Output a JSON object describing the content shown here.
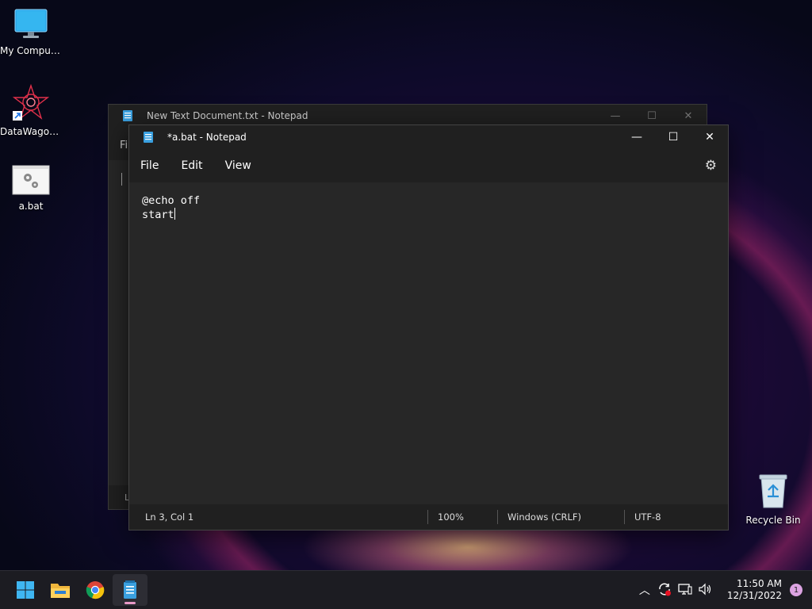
{
  "desktop": {
    "icons": [
      {
        "label": "My Computer"
      },
      {
        "label": "DataWagon..."
      },
      {
        "label": "a.bat"
      },
      {
        "label": "Recycle Bin"
      }
    ]
  },
  "background_window": {
    "title": "New Text Document.txt - Notepad",
    "menu_peek": "Fi",
    "status_peek": "L"
  },
  "window": {
    "title": "*a.bat - Notepad",
    "menu": {
      "file": "File",
      "edit": "Edit",
      "view": "View"
    },
    "content_lines": [
      "@echo off",
      "start"
    ],
    "status": {
      "position": "Ln 3, Col 1",
      "zoom": "100%",
      "line_ending": "Windows (CRLF)",
      "encoding": "UTF-8"
    }
  },
  "taskbar": {
    "apps": [
      "start-icon",
      "file-explorer-icon",
      "chrome-icon",
      "notepad-icon"
    ],
    "active_app": "notepad"
  },
  "tray": {
    "time": "11:50 AM",
    "date": "12/31/2022",
    "notifications": "1"
  },
  "colors": {
    "accent": "#e899c7",
    "window_bg": "#202020",
    "editor_bg": "#272727"
  }
}
